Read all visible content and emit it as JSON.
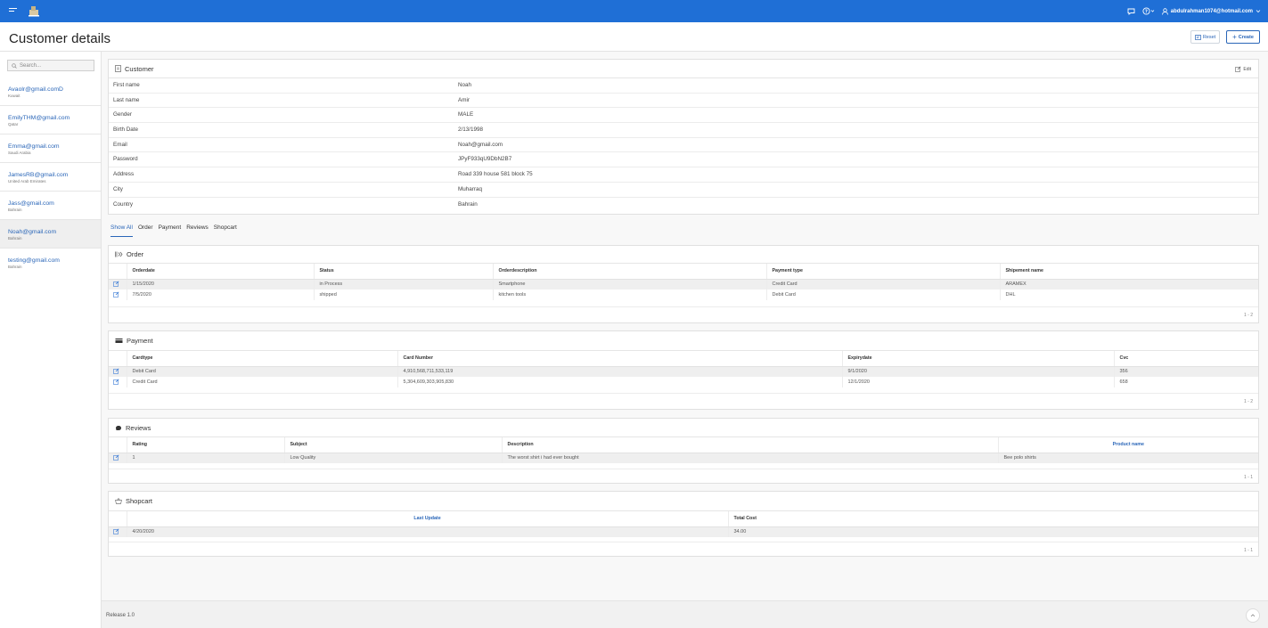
{
  "topbar": {
    "user": "abdulrahman1074@hotmail.com"
  },
  "page": {
    "title": "Customer details",
    "reset_label": "Reset",
    "create_label": "Create"
  },
  "search": {
    "placeholder": "Search..."
  },
  "sidebar": {
    "items": [
      {
        "email": "Avaolr@gmail.comD",
        "country": "Kuwait"
      },
      {
        "email": "EmilyTHM@gmail.com",
        "country": "Qatar"
      },
      {
        "email": "Emma@gmail.com",
        "country": "Saudi Arabia"
      },
      {
        "email": "JamesRB@gmail.com",
        "country": "United Arab Emirates"
      },
      {
        "email": "Jass@gmail.com",
        "country": "Bahrain"
      },
      {
        "email": "Noah@gmail.com",
        "country": "Bahrain"
      },
      {
        "email": "testing@gmail.com",
        "country": "Bahrain"
      }
    ]
  },
  "customer": {
    "title": "Customer",
    "edit_label": "Edit",
    "fields": [
      {
        "label": "First name",
        "value": "Noah"
      },
      {
        "label": "Last name",
        "value": "Amir"
      },
      {
        "label": "Gender",
        "value": "MALE"
      },
      {
        "label": "Birth Date",
        "value": "2/13/1998"
      },
      {
        "label": "Email",
        "value": "Noah@gmail.com"
      },
      {
        "label": "Password",
        "value": "JPyF933qU9DbN2B7"
      },
      {
        "label": "Address",
        "value": "Road 339 house 581 block 75"
      },
      {
        "label": "City",
        "value": "Muharraq"
      },
      {
        "label": "Country",
        "value": "Bahrain"
      }
    ]
  },
  "tabs": [
    "Show All",
    "Order",
    "Payment",
    "Reviews",
    "Shopcart"
  ],
  "order": {
    "title": "Order",
    "columns": [
      "Orderdate",
      "Status",
      "Orderdescription",
      "Payment type",
      "Shipement name"
    ],
    "rows": [
      [
        "1/15/2020",
        "in Process",
        "Smartphone",
        "Credit Card",
        "ARAMEX"
      ],
      [
        "7/5/2020",
        "shipped",
        "kitchen tools",
        "Debit Card",
        "DHL"
      ]
    ],
    "pager": "1 - 2"
  },
  "payment": {
    "title": "Payment",
    "columns": [
      "Cardtype",
      "Card Number",
      "Expirydate",
      "Cvc"
    ],
    "rows": [
      [
        "Debit Card",
        "4,910,568,711,533,119",
        "9/1/2020",
        "356"
      ],
      [
        "Credit Card",
        "5,304,609,303,905,830",
        "12/1/2020",
        "658"
      ]
    ],
    "pager": "1 - 2"
  },
  "reviews": {
    "title": "Reviews",
    "columns": [
      "Rating",
      "Subject",
      "Description",
      "Product name"
    ],
    "rows": [
      [
        "1",
        "Low Quality",
        "The worst shirt i had ever bought",
        "Bee polo shirts"
      ]
    ],
    "pager": "1 - 1"
  },
  "shopcart": {
    "title": "Shopcart",
    "columns": [
      "Last Update",
      "Total Cost"
    ],
    "rows": [
      [
        "4/20/2020",
        "34.00"
      ]
    ],
    "pager": "1 - 1"
  },
  "footer": {
    "release": "Release 1.0"
  }
}
